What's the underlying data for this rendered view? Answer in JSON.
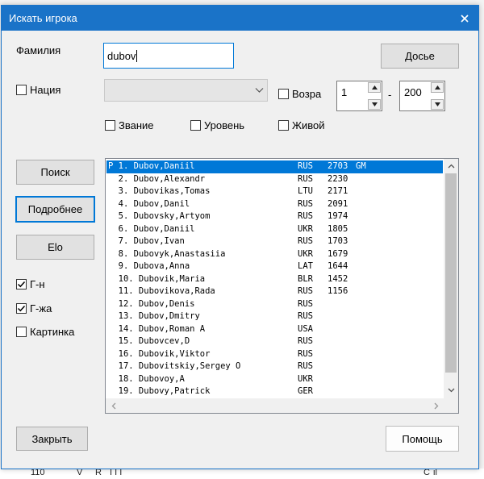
{
  "window": {
    "title": "Искать игрока"
  },
  "surname": {
    "label": "Фамилия",
    "value": "dubov"
  },
  "buttons": {
    "dossier": "Досье",
    "search": "Поиск",
    "details": "Подробнее",
    "elo": "Elo",
    "close": "Закрыть",
    "help": "Помощь"
  },
  "filters": {
    "nation": "Нация",
    "age": "Возра",
    "age_from": "1",
    "age_sep": "-",
    "age_to": "200",
    "rank": "Звание",
    "level": "Уровень",
    "alive": "Живой"
  },
  "options": {
    "male": {
      "label": "Г-н",
      "checked": true
    },
    "female": {
      "label": "Г-жа",
      "checked": true
    },
    "picture": {
      "label": "Картинка",
      "checked": false
    }
  },
  "players": [
    {
      "name": "P 1. Dubov,Daniil",
      "fed": "RUS",
      "elo": "2703",
      "title": "GM"
    },
    {
      "name": "  2. Dubov,Alexandr",
      "fed": "RUS",
      "elo": "2230",
      "title": ""
    },
    {
      "name": "  3. Dubovikas,Tomas",
      "fed": "LTU",
      "elo": "2171",
      "title": ""
    },
    {
      "name": "  4. Dubov,Danil",
      "fed": "RUS",
      "elo": "2091",
      "title": ""
    },
    {
      "name": "  5. Dubovsky,Artyom",
      "fed": "RUS",
      "elo": "1974",
      "title": ""
    },
    {
      "name": "  6. Dubov,Daniil",
      "fed": "UKR",
      "elo": "1805",
      "title": ""
    },
    {
      "name": "  7. Dubov,Ivan",
      "fed": "RUS",
      "elo": "1703",
      "title": ""
    },
    {
      "name": "  8. Dubovyk,Anastasiia",
      "fed": "UKR",
      "elo": "1679",
      "title": ""
    },
    {
      "name": "  9. Dubova,Anna",
      "fed": "LAT",
      "elo": "1644",
      "title": ""
    },
    {
      "name": "  10. Dubovik,Maria",
      "fed": "BLR",
      "elo": "1452",
      "title": ""
    },
    {
      "name": "  11. Dubovikova,Rada",
      "fed": "RUS",
      "elo": "1156",
      "title": ""
    },
    {
      "name": "  12. Dubov,Denis",
      "fed": "RUS",
      "elo": "",
      "title": ""
    },
    {
      "name": "  13. Dubov,Dmitry",
      "fed": "RUS",
      "elo": "",
      "title": ""
    },
    {
      "name": "  14. Dubov,Roman A",
      "fed": "USA",
      "elo": "",
      "title": ""
    },
    {
      "name": "  15. Dubovcev,D",
      "fed": "RUS",
      "elo": "",
      "title": ""
    },
    {
      "name": "  16. Dubovik,Viktor",
      "fed": "RUS",
      "elo": "",
      "title": ""
    },
    {
      "name": "  17. Dubovitskiy,Sergey O",
      "fed": "RUS",
      "elo": "",
      "title": ""
    },
    {
      "name": "  18. Dubovoy,A",
      "fed": "UKR",
      "elo": "",
      "title": ""
    },
    {
      "name": "  19. Dubovy,Patrick",
      "fed": "GER",
      "elo": "",
      "title": ""
    }
  ],
  "selected_index": 0,
  "background_status": [
    "110",
    "V",
    "R",
    "I I I",
    "C",
    "il"
  ],
  "colors": {
    "accent": "#0078d7",
    "titlebar": "#1a73c8"
  }
}
